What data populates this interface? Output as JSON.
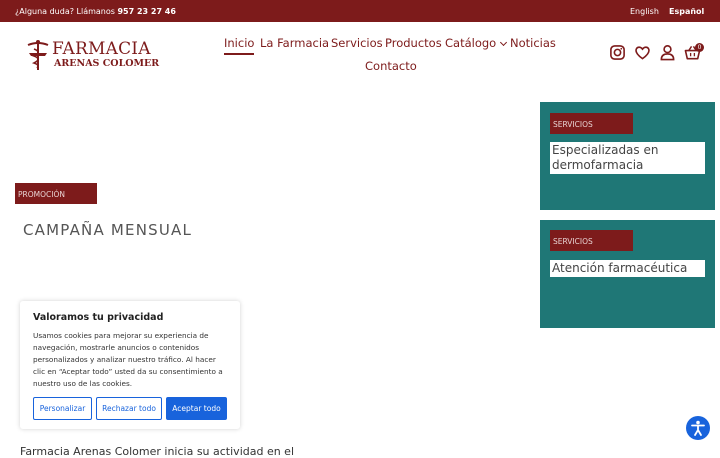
{
  "topbar": {
    "question": "¿Alguna duda? Llámanos",
    "phone": "957 23 27 46",
    "lang_en": "English",
    "lang_es": "Español"
  },
  "brand": {
    "line1": "FARMACIA",
    "line2": "ARENAS COLOMER",
    "color": "#7d1b1b"
  },
  "nav": {
    "items": [
      "Inicio",
      "La Farmacia",
      "Servicios",
      "Productos",
      "Catálogo",
      "Noticias",
      "Contacto"
    ],
    "active": "Inicio"
  },
  "header_icons": {
    "instagram": "instagram-icon",
    "favorites": "heart-icon",
    "account": "user-icon",
    "cart": "basket-icon",
    "cart_count": "0"
  },
  "promo": {
    "tag": "PROMOCIÓN",
    "title": "CAMPAÑA MENSUAL"
  },
  "services": [
    {
      "tag": "SERVICIOS",
      "text": "Especializadas en dermofarmacia"
    },
    {
      "tag": "SERVICIOS",
      "text": "Atención farmacéutica"
    }
  ],
  "cookie": {
    "title": "Valoramos tu privacidad",
    "body": "Usamos cookies para mejorar su experiencia de navegación, mostrarle anuncios o contenidos personalizados y analizar nuestro tráfico. Al hacer clic en “Aceptar todo” usted da su consentimiento a nuestro uso de las cookies.",
    "customize": "Personalizar",
    "reject": "Rechazar todo",
    "accept": "Aceptar todo",
    "accent": "#1863dc"
  },
  "colors": {
    "maroon": "#7d1b1b",
    "teal": "#1f7776"
  },
  "footer_text": "Farmacia Arenas Colomer inicia su actividad en el"
}
